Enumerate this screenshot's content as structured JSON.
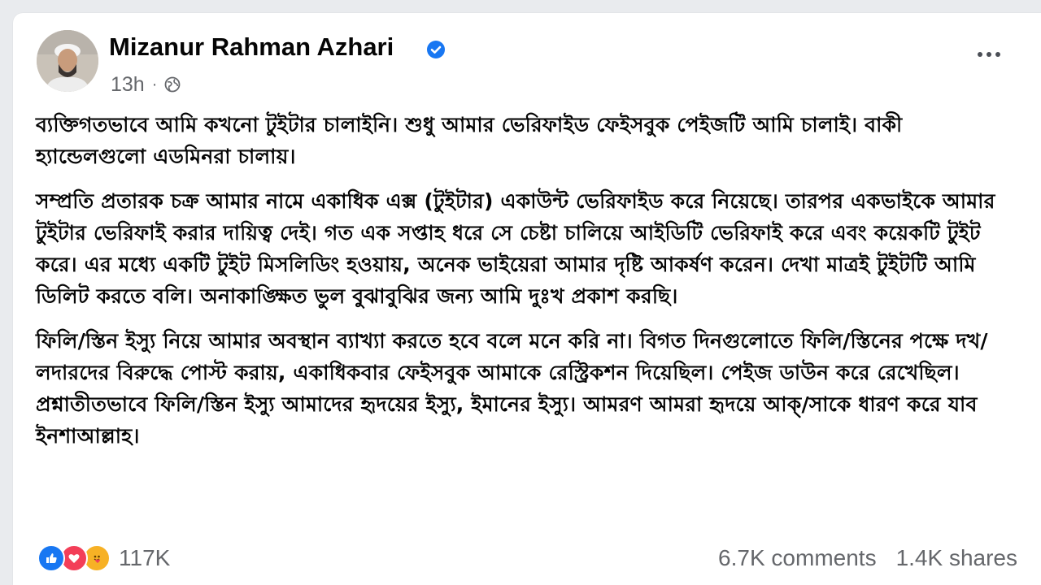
{
  "post": {
    "author": "Mizanur Rahman Azhari",
    "time": "13h",
    "separator": "·",
    "audience_icon": "globe-icon",
    "verified_icon": "verified-badge-icon",
    "colors": {
      "verified": "#1877f2",
      "like": "#1877f2",
      "love": "#f33e58",
      "care": "#f7b125"
    },
    "paragraphs": [
      "ব্যক্তিগতভাবে আমি কখনো টুইটার চালাইনি। শুধু আমার ভেরিফাইড ফেইসবুক পেইজটি আমি চালাই। বাকী হ্যান্ডেলগুলো এডমিনরা চালায়।",
      "সম্প্রতি প্রতারক চক্র আমার নামে একাধিক এক্স (টুইটার) একাউন্ট ভেরিফাইড করে নিয়েছে। তারপর একভাইকে আমার টুইটার ভেরিফাই করার দায়িত্ব দেই। গত এক সপ্তাহ ধরে সে চেষ্টা চালিয়ে আইডিটি ভেরিফাই করে এবং কয়েকটি টুইট করে। এর মধ্যে একটি টুইট মিসলিডিং হওয়ায়, অনেক ভাইয়েরা আমার দৃষ্টি আকর্ষণ করেন। দেখা মাত্রই টুইটটি আমি ডিলিট করতে বলি। অনাকাঙ্ক্ষিত ভুল বুঝাবুঝির জন্য আমি দুঃখ প্রকাশ করছি।",
      "ফিলি/স্তিন ইস্যু নিয়ে আমার অবস্থান ব্যাখ্যা করতে হবে বলে মনে করি না। বিগত দিনগুলোতে ফিলি/স্তিনের পক্ষে দখ/লদারদের বিরুদ্ধে পোস্ট করায়, একাধিকবার ফেইসবুক আমাকে রেস্ট্রিকশন দিয়েছিল। পেইজ ডাউন করে রেখেছিল। প্রশ্নাতীতভাবে ফিলি/স্তিন ইস্যু আমাদের হৃদয়ের ইস্যু, ইমানের ইস্যু। আমরণ আমরা হৃদয়ে আক্/সাকে ধারণ করে যাব ইনশাআল্লাহ।"
    ],
    "reactions": {
      "icons": [
        "like-icon",
        "love-icon",
        "care-icon"
      ],
      "count": "117K"
    },
    "comments": "6.7K comments",
    "shares": "1.4K shares"
  }
}
